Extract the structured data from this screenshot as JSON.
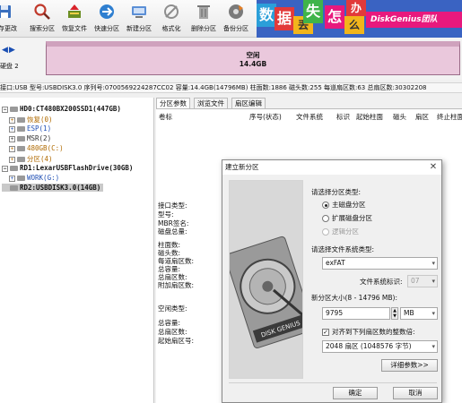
{
  "toolbar": {
    "buttons": [
      {
        "label": "保存更改",
        "icon": "save-icon"
      },
      {
        "label": "搜索分区",
        "icon": "search-icon"
      },
      {
        "label": "恢复文件",
        "icon": "recover-icon"
      },
      {
        "label": "快速分区",
        "icon": "quick-partition-icon"
      },
      {
        "label": "新建分区",
        "icon": "new-partition-icon"
      },
      {
        "label": "格式化",
        "icon": "format-icon"
      },
      {
        "label": "删除分区",
        "icon": "delete-icon"
      },
      {
        "label": "备份分区",
        "icon": "backup-icon"
      }
    ]
  },
  "banner": {
    "chars": [
      "数",
      "据",
      "丢",
      "失",
      "怎",
      "么",
      "办"
    ],
    "brand": "DiskGenius团队"
  },
  "diskbar": {
    "disk_label": "硬盘 2",
    "partition_label": "空闲",
    "partition_size": "14.4GB"
  },
  "info_line": "接口:USB  型号:USBDISK3.0  序列号:0700569224287CC02  容量:14.4GB(14796MB)  柱面数:1886  磁头数:255  每道扇区数:63  总扇区数:30302208",
  "tree": {
    "nodes": [
      {
        "label": "HD0:CT480BX200SSD1(447GB)",
        "type": "disk"
      },
      {
        "label": "恢复(0)",
        "type": "part",
        "color": "#b06a00"
      },
      {
        "label": "ESP(1)",
        "type": "part",
        "color": "#1f4fb4"
      },
      {
        "label": "MSR(2)",
        "type": "part",
        "color": "#333333"
      },
      {
        "label": "480GB(C:)",
        "type": "part",
        "color": "#b06a00"
      },
      {
        "label": "分区(4)",
        "type": "part",
        "color": "#b06a00"
      },
      {
        "label": "RD1:LexarUSBFlashDrive(30GB)",
        "type": "disk"
      },
      {
        "label": "WORK(G:)",
        "type": "part",
        "color": "#1f4fb4"
      },
      {
        "label": "RD2:USBDISK3.0(14GB)",
        "type": "disk"
      }
    ]
  },
  "tabs": [
    "分区参数",
    "浏览文件",
    "扇区编辑"
  ],
  "columns": [
    "卷标",
    "序号(状态)",
    "文件系统",
    "标识",
    "起始柱面",
    "磁头",
    "扇区",
    "终止柱面"
  ],
  "props": {
    "group1": [
      "接口类型:",
      "型号:",
      "MBR签名:",
      "磁盘总量:"
    ],
    "group2": [
      "柱面数:",
      "磁头数:",
      "每道扇区数:",
      "总容量:",
      "总扇区数:",
      "附加扇区数:"
    ],
    "group3": [
      "空闲类型:"
    ],
    "group4": [
      "总容量:",
      "总扇区数:",
      "起始扇区号:"
    ]
  },
  "dialog": {
    "title": "建立新分区",
    "select_type_label": "请选择分区类型:",
    "radio_primary": "主磁盘分区",
    "radio_extended": "扩展磁盘分区",
    "radio_logical": "逻辑分区",
    "fs_label": "请选择文件系统类型:",
    "fs_value": "exFAT",
    "fs_id_label": "文件系统标识:",
    "fs_id_value": "07",
    "size_label": "新分区大小(8 - 14796 MB):",
    "size_value": "9795",
    "size_unit": "MB",
    "align_label": "对齐到下列扇区数的整数倍:",
    "align_value": "2048 扇区 (1048576 字节)",
    "details_button": "详细参数>>",
    "ok_button": "确定",
    "cancel_button": "取消",
    "image_text": "DISK GENIUS"
  },
  "colors": {
    "partition_fill": "#eac8dc",
    "banner_blue": "#3a63c2",
    "brand_pink": "#e8197d"
  }
}
